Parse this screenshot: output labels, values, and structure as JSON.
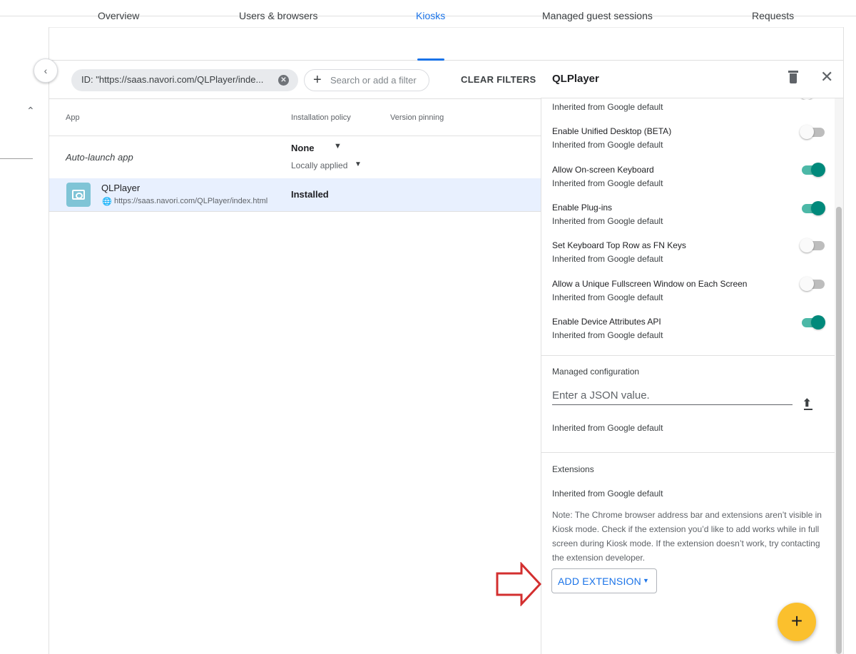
{
  "tabs": [
    {
      "label": "Overview"
    },
    {
      "label": "Users & browsers"
    },
    {
      "label": "Kiosks"
    },
    {
      "label": "Managed guest sessions"
    },
    {
      "label": "Requests"
    }
  ],
  "active_tab": "Kiosks",
  "filter": {
    "chip_label": "ID: \"https://saas.navori.com/QLPlayer/inde...",
    "search_placeholder": "Search or add a filter",
    "clear_label": "CLEAR FILTERS"
  },
  "table": {
    "headers": {
      "app": "App",
      "installation_policy": "Installation policy",
      "version_pinning": "Version pinning"
    },
    "autolaunch": {
      "label": "Auto-launch app",
      "value": "None",
      "sub": "Locally applied"
    },
    "rows": [
      {
        "name": "QLPlayer",
        "url": "https://saas.navori.com/QLPlayer/index.html",
        "policy": "Installed"
      }
    ]
  },
  "panel": {
    "title": "QLPlayer",
    "first_sub": "Inherited from Google default",
    "settings": [
      {
        "title": "Enable Unified Desktop (BETA)",
        "sub": "Inherited from Google default",
        "on": false
      },
      {
        "title": "Allow On-screen Keyboard",
        "sub": "Inherited from Google default",
        "on": true
      },
      {
        "title": "Enable Plug-ins",
        "sub": "Inherited from Google default",
        "on": true
      },
      {
        "title": "Set Keyboard Top Row as FN Keys",
        "sub": "Inherited from Google default",
        "on": false
      },
      {
        "title": "Allow a Unique Fullscreen Window on Each Screen",
        "sub": "Inherited from Google default",
        "on": false
      },
      {
        "title": "Enable Device Attributes API",
        "sub": "Inherited from Google default",
        "on": true
      }
    ],
    "managed_config": {
      "label": "Managed configuration",
      "placeholder": "Enter a JSON value.",
      "sub": "Inherited from Google default"
    },
    "extensions": {
      "label": "Extensions",
      "sub": "Inherited from Google default",
      "note": "Note: The Chrome browser address bar and extensions aren’t visible in Kiosk mode. Check if the extension you’d like to add works while in full screen during Kiosk mode. If the extension doesn’t work, try contacting the extension developer.",
      "button_label": "ADD EXTENSION"
    }
  },
  "fab_label": "+",
  "colors": {
    "accent": "#1a73e8",
    "toggle_on": "#00897b",
    "fab": "#fbc02d",
    "annotation_arrow": "#d32f2f"
  }
}
